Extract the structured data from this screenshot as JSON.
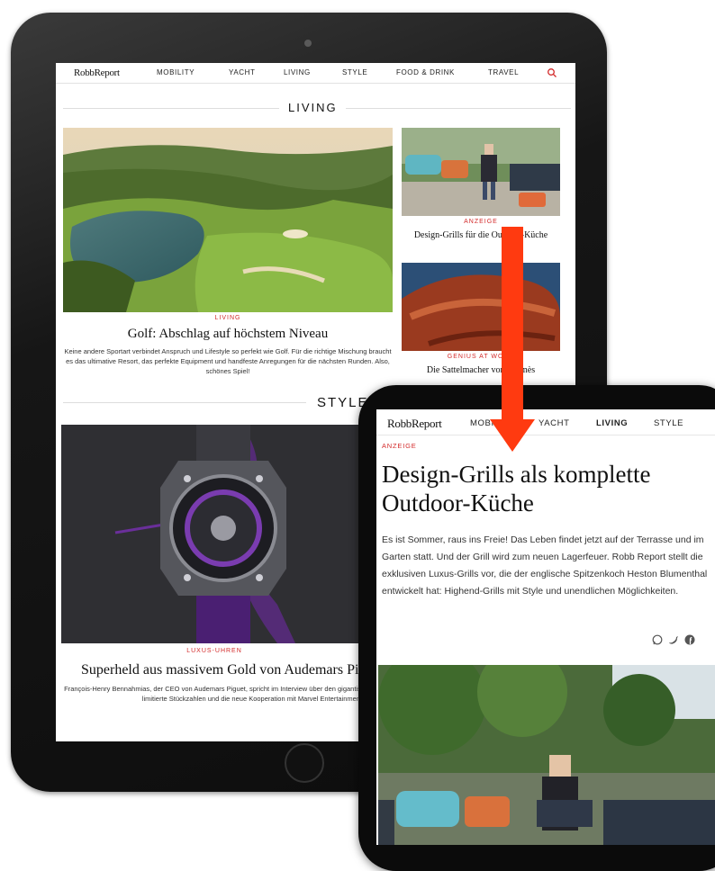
{
  "colors": {
    "accent": "#d32a2a",
    "arrow": "#ff3a10",
    "text": "#111111",
    "rule": "#dddddd"
  },
  "tablet": {
    "logo": "RobbReport",
    "nav": [
      "MOBILITY",
      "YACHT",
      "LIVING",
      "STYLE",
      "FOOD & DRINK",
      "TRAVEL"
    ],
    "search_icon": "search-icon",
    "section_living": "LIVING",
    "section_style": "STYLE",
    "main_article": {
      "category": "LIVING",
      "title": "Golf: Abschlag auf höchstem Niveau",
      "teaser": "Keine andere Sportart verbindet Anspruch und Lifestyle so perfekt wie Golf. Für die richtige Mischung braucht es das ultimative Resort, das perfekte Equipment und handfeste Anregungen für die nächsten Runden. Also, schönes Spiel!"
    },
    "side_article_1": {
      "category": "ANZEIGE",
      "title": "Design-Grills für die Outdoor-Küche"
    },
    "side_article_2": {
      "category": "GENIUS AT WORK",
      "title": "Die Sattelmacher von Hermès"
    },
    "style_article": {
      "category": "LUXUS-UHREN",
      "title": "Superheld aus massivem Gold von Audemars Piguet",
      "teaser": "François-Henry Bennahmias, der CEO von Audemars Piguet, spricht im Interview über den gigantischen Erfolg der Royal Oak, limitierte Stückzahlen und die neue Kooperation mit Marvel Entertainment."
    }
  },
  "phone": {
    "logo": "RobbReport",
    "nav": [
      "MOBILITY",
      "YACHT",
      "LIVING",
      "STYLE"
    ],
    "category": "ANZEIGE",
    "title": "Design-Grills als komplette Outdoor-Küche",
    "body": "Es ist Sommer, raus ins Freie! Das Leben findet jetzt auf der Terrasse und im Garten statt. Und der Grill wird zum neuen Lagerfeuer. Robb Report stellt die exklusiven Luxus-Grills vor, die der englische Spitzenkoch Heston Blumenthal entwickelt hat: Highend-Grills mit Style und unendlichen Möglichkeiten.",
    "share_icons": [
      "whatsapp-icon",
      "twitter-icon",
      "facebook-icon"
    ]
  }
}
